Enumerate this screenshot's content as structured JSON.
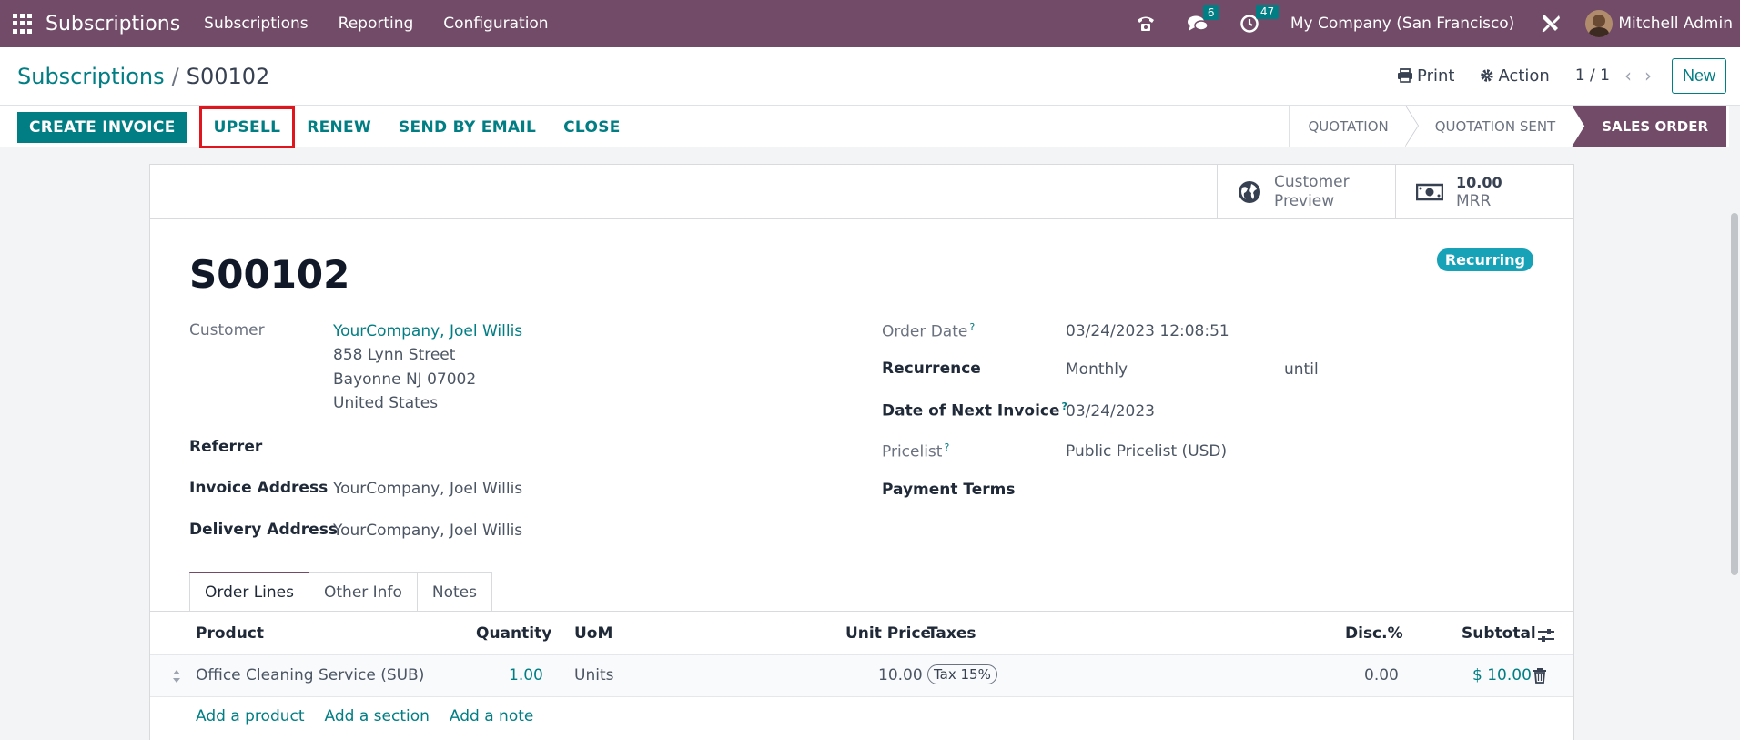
{
  "navbar": {
    "brand": "Subscriptions",
    "menu": [
      "Subscriptions",
      "Reporting",
      "Configuration"
    ],
    "messages_count": "6",
    "activities_count": "47",
    "company": "My Company (San Francisco)",
    "user": "Mitchell Admin"
  },
  "control": {
    "breadcrumb_parent": "Subscriptions",
    "breadcrumb_sep": "/",
    "breadcrumb_current": "S00102",
    "print_label": "Print",
    "action_label": "Action",
    "pager": "1 / 1",
    "new_label": "New"
  },
  "statusbar": {
    "buttons": [
      "CREATE INVOICE",
      "UPSELL",
      "RENEW",
      "SEND BY EMAIL",
      "CLOSE"
    ],
    "stages": [
      "QUOTATION",
      "QUOTATION SENT",
      "SALES ORDER"
    ],
    "active_stage": "SALES ORDER"
  },
  "smart_buttons": {
    "preview_line1": "Customer",
    "preview_line2": "Preview",
    "mrr_value": "10.00",
    "mrr_label": "MRR"
  },
  "form": {
    "name": "S00102",
    "badge": "Recurring",
    "customer_label": "Customer",
    "customer_name": "YourCompany, Joel Willis",
    "customer_street": "858 Lynn Street",
    "customer_city": "Bayonne NJ 07002",
    "customer_country": "United States",
    "referrer_label": "Referrer",
    "invoice_address_label": "Invoice Address",
    "invoice_address": "YourCompany, Joel Willis",
    "delivery_address_label": "Delivery Address",
    "delivery_address": "YourCompany, Joel Willis",
    "order_date_label": "Order Date",
    "order_date": "03/24/2023 12:08:51",
    "recurrence_label": "Recurrence",
    "recurrence": "Monthly",
    "until_label": "until",
    "next_invoice_label": "Date of Next Invoice",
    "next_invoice": "03/24/2023",
    "pricelist_label": "Pricelist",
    "pricelist": "Public Pricelist (USD)",
    "payment_terms_label": "Payment Terms"
  },
  "tabs": [
    "Order Lines",
    "Other Info",
    "Notes"
  ],
  "table": {
    "headers": {
      "product": "Product",
      "quantity": "Quantity",
      "uom": "UoM",
      "unit_price": "Unit Price",
      "taxes": "Taxes",
      "disc": "Disc.%",
      "subtotal": "Subtotal"
    },
    "rows": [
      {
        "product": "Office Cleaning Service (SUB)",
        "quantity": "1.00",
        "uom": "Units",
        "unit_price": "10.00",
        "tax": "Tax 15%",
        "disc": "0.00",
        "subtotal": "$ 10.00"
      }
    ],
    "add_product": "Add a product",
    "add_section": "Add a section",
    "add_note": "Add a note"
  },
  "colors": {
    "brand": "#714b67",
    "accent": "#017e84",
    "highlight": "#e0161e",
    "badge": "#17a2b8"
  }
}
